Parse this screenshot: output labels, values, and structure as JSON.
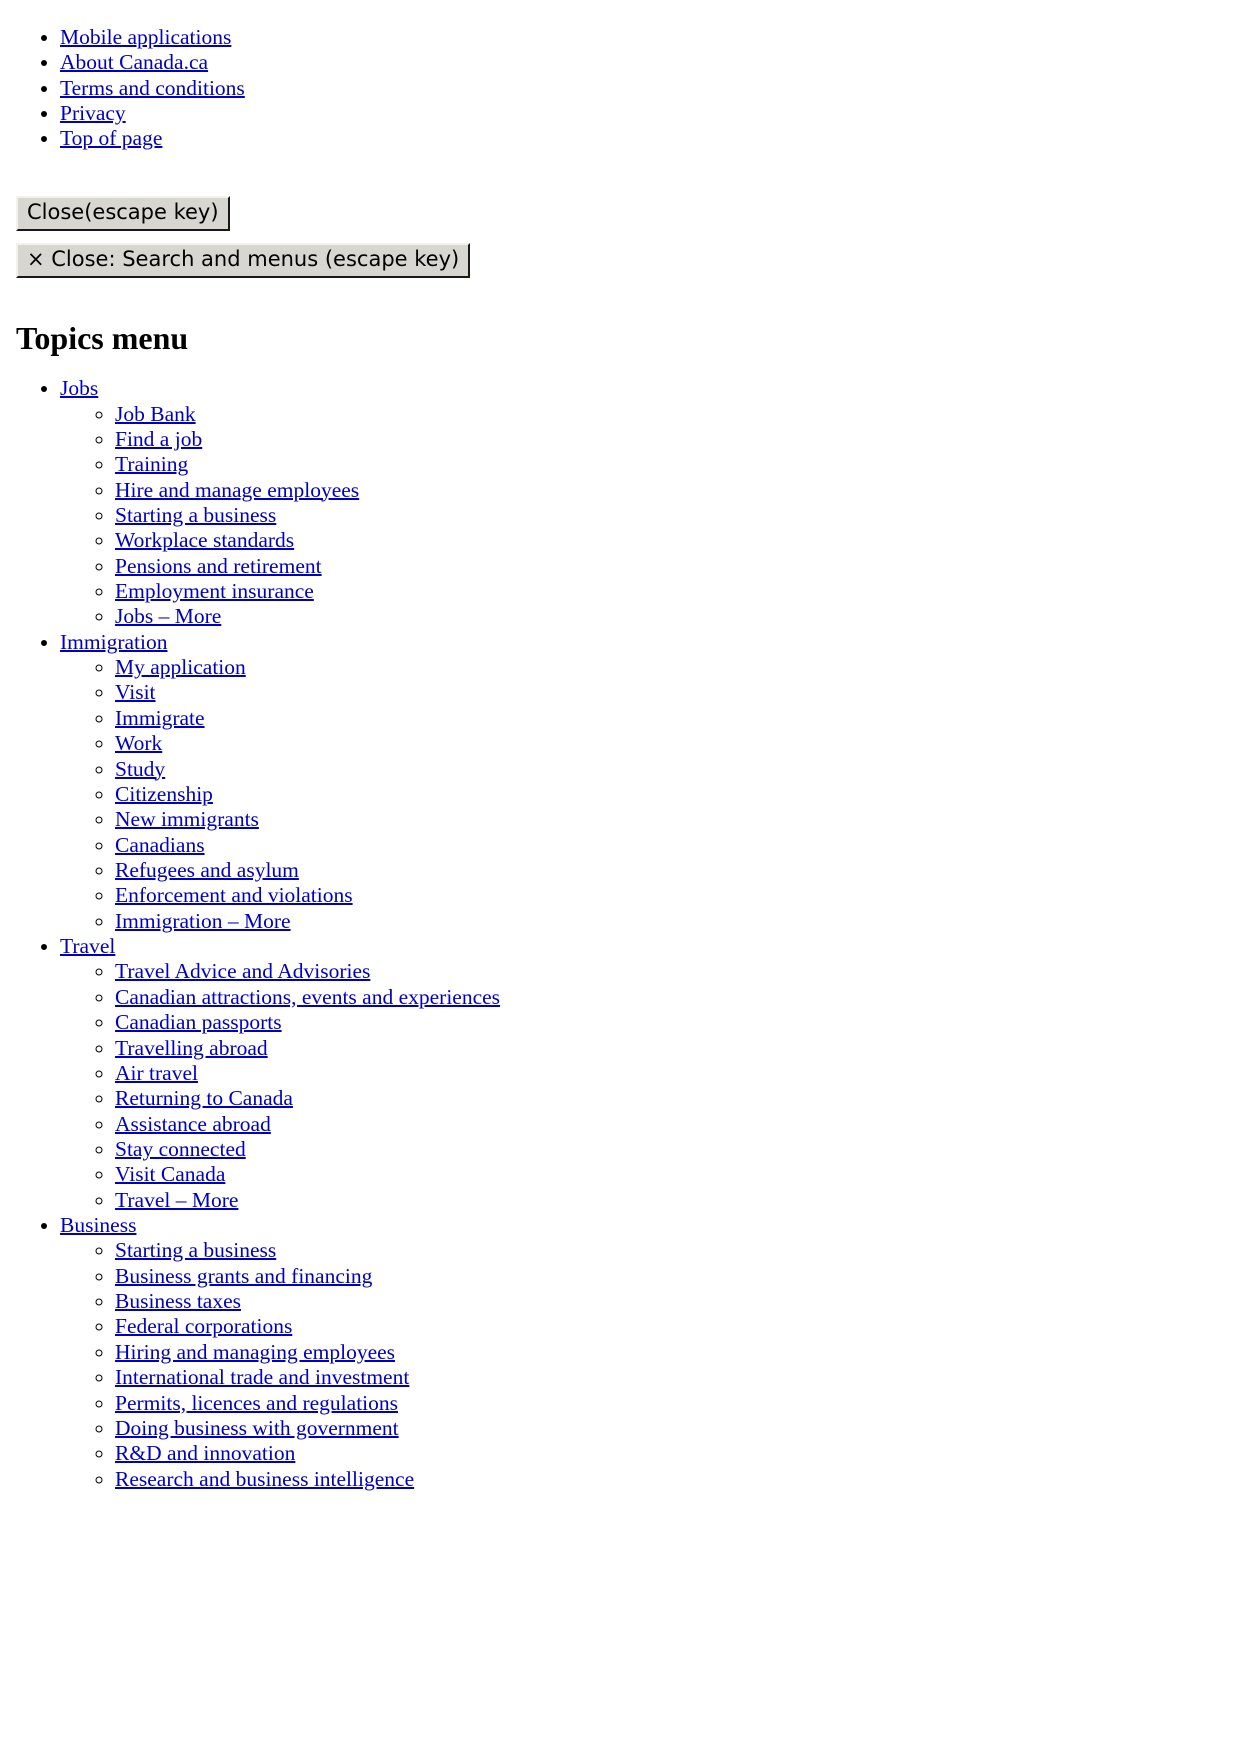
{
  "footer_links": [
    {
      "label": "Mobile applications"
    },
    {
      "label": "About Canada.ca"
    },
    {
      "label": "Terms and conditions"
    },
    {
      "label": "Privacy"
    },
    {
      "label": "Top of page"
    }
  ],
  "buttons": {
    "close": "Close(escape key)",
    "close_search_menus": "× Close: Search and menus (escape key)"
  },
  "heading": "Topics menu",
  "topics": [
    {
      "label": "Jobs",
      "children": [
        {
          "label": "Job Bank"
        },
        {
          "label": "Find a job"
        },
        {
          "label": "Training"
        },
        {
          "label": "Hire and manage employees"
        },
        {
          "label": "Starting a business"
        },
        {
          "label": "Workplace standards"
        },
        {
          "label": "Pensions and retirement"
        },
        {
          "label": "Employment insurance"
        },
        {
          "label": "Jobs – More"
        }
      ]
    },
    {
      "label": "Immigration",
      "children": [
        {
          "label": "My application"
        },
        {
          "label": "Visit"
        },
        {
          "label": "Immigrate"
        },
        {
          "label": "Work"
        },
        {
          "label": "Study"
        },
        {
          "label": "Citizenship"
        },
        {
          "label": "New immigrants"
        },
        {
          "label": "Canadians"
        },
        {
          "label": "Refugees and asylum"
        },
        {
          "label": "Enforcement and violations"
        },
        {
          "label": "Immigration – More"
        }
      ]
    },
    {
      "label": "Travel",
      "children": [
        {
          "label": "Travel Advice and Advisories"
        },
        {
          "label": "Canadian attractions, events and experiences"
        },
        {
          "label": "Canadian passports"
        },
        {
          "label": "Travelling abroad"
        },
        {
          "label": "Air travel"
        },
        {
          "label": "Returning to Canada"
        },
        {
          "label": "Assistance abroad"
        },
        {
          "label": "Stay connected"
        },
        {
          "label": "Visit Canada"
        },
        {
          "label": "Travel – More"
        }
      ]
    },
    {
      "label": "Business",
      "children": [
        {
          "label": "Starting a business"
        },
        {
          "label": "Business grants and financing"
        },
        {
          "label": "Business taxes"
        },
        {
          "label": "Federal corporations"
        },
        {
          "label": "Hiring and managing employees"
        },
        {
          "label": "International trade and investment"
        },
        {
          "label": "Permits, licences and regulations"
        },
        {
          "label": "Doing business with government"
        },
        {
          "label": "R&D and innovation"
        },
        {
          "label": "Research and business intelligence"
        }
      ]
    }
  ]
}
